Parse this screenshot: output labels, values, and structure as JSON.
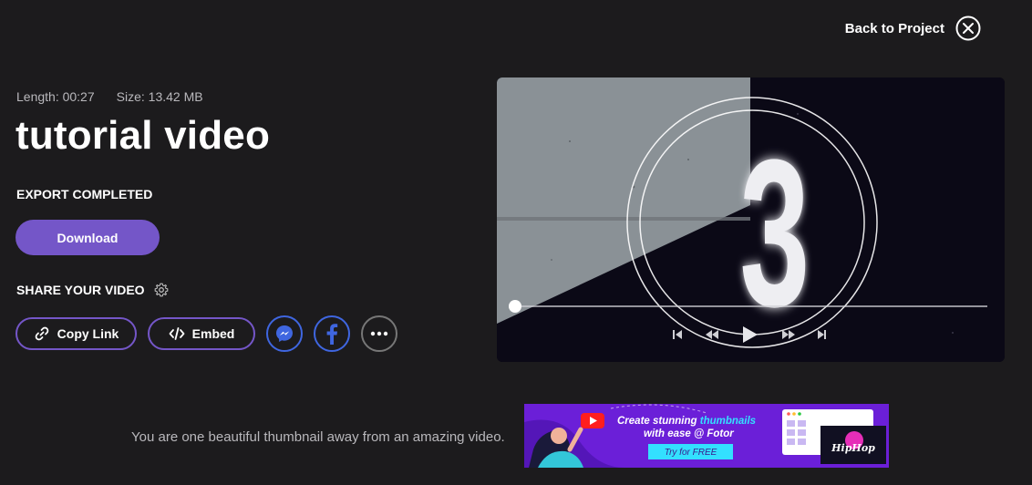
{
  "header": {
    "back_label": "Back to Project"
  },
  "video": {
    "length_text": "Length: 00:27",
    "size_text": "Size: 13.42 MB",
    "title": "tutorial video",
    "status": "EXPORT COMPLETED",
    "countdown_number": "3",
    "progress": 0.0
  },
  "actions": {
    "download_label": "Download",
    "share_heading": "SHARE YOUR VIDEO",
    "copy_link_label": "Copy Link",
    "embed_label": "Embed"
  },
  "promo": {
    "text": "You are one beautiful thumbnail away from an amazing video.",
    "banner_line1a": "Create stunning ",
    "banner_line1b": "thumbnails",
    "banner_line2": "with ease @ Fotor",
    "banner_cta": "Try for FREE",
    "banner_thumb_text": "HipHop"
  },
  "colors": {
    "accent": "#7456c8",
    "social_blue": "#3f66e0",
    "background": "#1c1b1d",
    "banner_purple": "#6b1fd8",
    "banner_cyan": "#33e0ff"
  },
  "icons": {
    "close": "close-icon",
    "settings": "gear-icon",
    "link": "link-icon",
    "code": "code-icon",
    "messenger": "messenger-icon",
    "facebook": "facebook-icon",
    "more": "more-icon"
  }
}
